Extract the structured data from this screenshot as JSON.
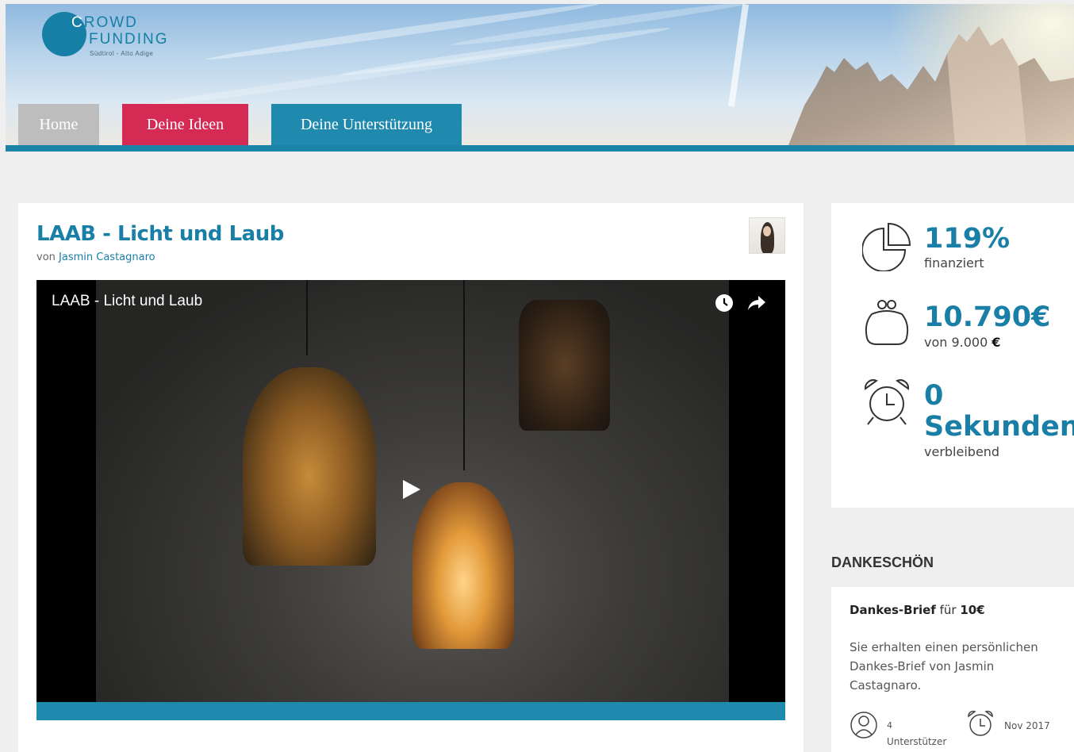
{
  "logo": {
    "line1_first": "C",
    "line1_rest": "ROWD",
    "line2": "FUNDING",
    "line3": "Südtirol - Alto Adige"
  },
  "nav": {
    "home": "Home",
    "ideas": "Deine Ideen",
    "support": "Deine Unterstützung"
  },
  "colors": {
    "primary": "#1a7fa6",
    "accent": "#d52a54",
    "nav_inactive": "#bdbdbd"
  },
  "project": {
    "title": "LAAB - Licht und Laub",
    "by_prefix": "von",
    "author": "Jasmin Castagnaro",
    "avatar_icon": "author-avatar"
  },
  "video": {
    "title": "LAAB - Licht und Laub",
    "icons": [
      "watch-later-icon",
      "share-icon",
      "play-icon"
    ]
  },
  "stats": {
    "funded_value": "119%",
    "funded_label": "finanziert",
    "amount_value": "10.790€",
    "amount_prefix": "von 9.000",
    "amount_currency": "€",
    "time_value": "0",
    "time_unit": "Sekunden",
    "time_label": "verbleibend"
  },
  "rewards": {
    "heading": "DANKESCHÖN",
    "items": [
      {
        "name": "Dankes-Brief",
        "for": "für",
        "price": "10€",
        "description": "Sie erhalten einen persönlichen Dankes-Brief von Jasmin Castagnaro.",
        "supporters_count": "4",
        "supporters_label": "Unterstützer",
        "date": "Nov 2017"
      }
    ]
  }
}
